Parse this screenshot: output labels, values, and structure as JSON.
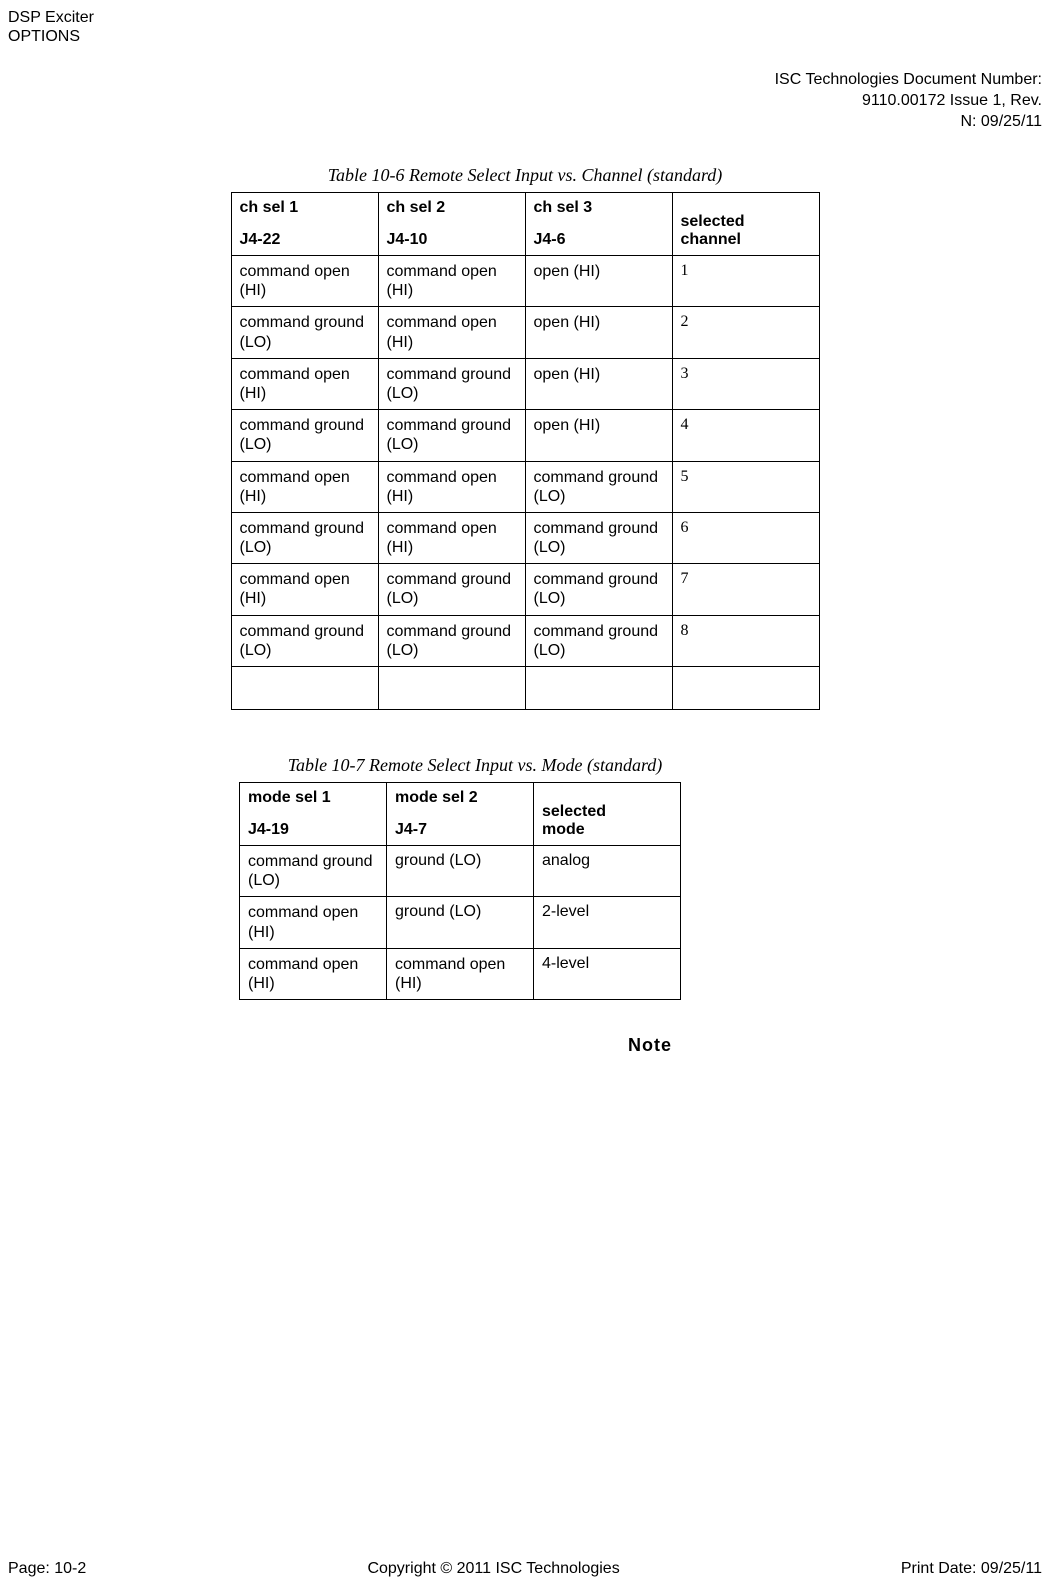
{
  "header": {
    "line1": "DSP Exciter",
    "line2": "OPTIONS",
    "right_line1": "ISC Technologies Document Number:",
    "right_line2": "9110.00172 Issue 1, Rev.",
    "right_line3": "N: 09/25/11"
  },
  "table1": {
    "caption": "Table 10-6 Remote Select Input vs. Channel (standard)",
    "headers": {
      "c1a": "ch sel 1",
      "c1b": "J4-22",
      "c2a": "ch sel 2",
      "c2b": "J4-10",
      "c3a": "ch sel 3",
      "c3b": "J4-6",
      "c4a": "selected",
      "c4b": "channel"
    },
    "rows": [
      {
        "c1": "command open (HI)",
        "c2": "command open (HI)",
        "c3": "open (HI)",
        "c4": "1"
      },
      {
        "c1": "command ground (LO)",
        "c2": "command open (HI)",
        "c3": "open (HI)",
        "c4": "2"
      },
      {
        "c1": "command open (HI)",
        "c2": "command ground (LO)",
        "c3": "open (HI)",
        "c4": "3"
      },
      {
        "c1": "command ground (LO)",
        "c2": "command ground (LO)",
        "c3": "open (HI)",
        "c4": "4"
      },
      {
        "c1": "command open (HI)",
        "c2": "command open (HI)",
        "c3": "command ground (LO)",
        "c4": "5"
      },
      {
        "c1": "command ground (LO)",
        "c2": "command open (HI)",
        "c3": "command ground (LO)",
        "c4": "6"
      },
      {
        "c1": "command open (HI)",
        "c2": "command ground (LO)",
        "c3": "command ground (LO)",
        "c4": "7"
      },
      {
        "c1": "command ground (LO)",
        "c2": "command ground (LO)",
        "c3": "command ground (LO)",
        "c4": "8"
      }
    ]
  },
  "table2": {
    "caption": "Table 10-7 Remote Select Input vs. Mode (standard)",
    "headers": {
      "c1a": "mode sel 1",
      "c1b": "J4-19",
      "c2a": "mode sel 2",
      "c2b": "J4-7",
      "c3a": "selected",
      "c3b": "mode"
    },
    "rows": [
      {
        "c1": "command ground (LO)",
        "c2": "ground (LO)",
        "c3": "analog"
      },
      {
        "c1": "command open (HI)",
        "c2": "ground (LO)",
        "c3": "2-level"
      },
      {
        "c1": "command open (HI)",
        "c2": "command open (HI)",
        "c3": "4-level"
      }
    ]
  },
  "note": "Note",
  "footer": {
    "left": "Page: 10-2",
    "center": "Copyright © 2011 ISC Technologies",
    "right": "Print Date: 09/25/11"
  }
}
